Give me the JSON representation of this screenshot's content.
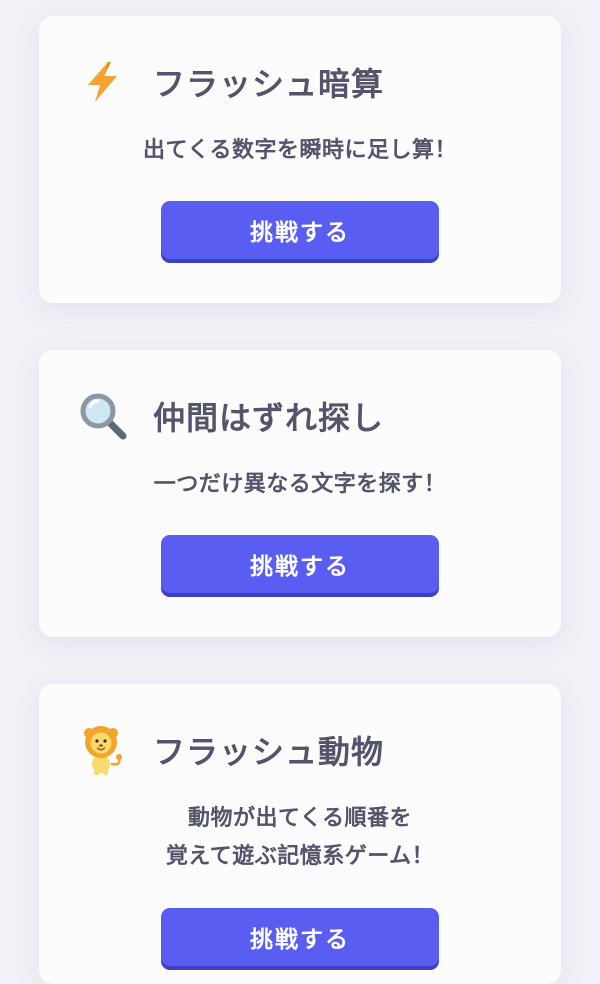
{
  "games": [
    {
      "icon": "lightning-icon",
      "title": "フラッシュ暗算",
      "description": [
        "出てくる数字を瞬時に足し算！"
      ],
      "button_label": "挑戦する"
    },
    {
      "icon": "magnifier-icon",
      "title": "仲間はずれ探し",
      "description": [
        "一つだけ異なる文字を探す！"
      ],
      "button_label": "挑戦する"
    },
    {
      "icon": "lion-icon",
      "title": "フラッシュ動物",
      "description": [
        "動物が出てくる順番を",
        "覚えて遊ぶ記憶系ゲーム！"
      ],
      "button_label": "挑戦する"
    }
  ],
  "colors": {
    "background": "#f1f1f7",
    "card": "#fcfcfd",
    "button": "#5a5df2",
    "button_shadow": "#3f3fc4",
    "text": "#54546a",
    "lightning": "#f4a433",
    "lion_mane": "#f3a42a",
    "lion_face": "#fbd96b"
  }
}
